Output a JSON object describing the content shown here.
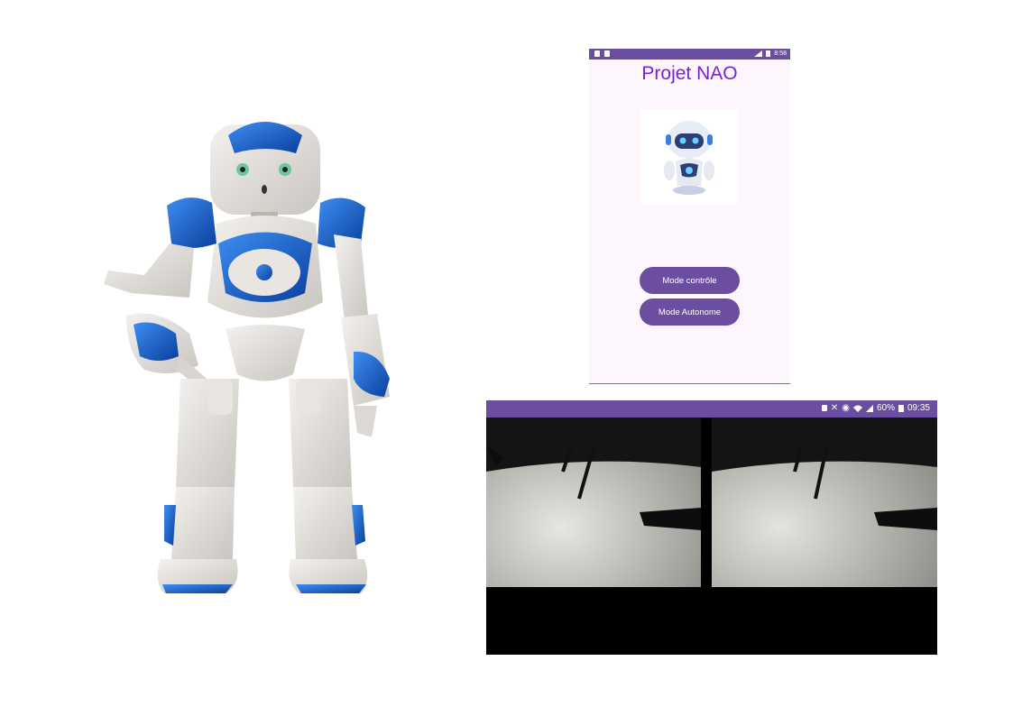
{
  "app": {
    "title": "Projet NAO",
    "status_time": "8:58",
    "buttons": {
      "control": "Mode contrôle",
      "autonomous": "Mode Autonome"
    }
  },
  "video_screen": {
    "status_battery": "60%",
    "status_time": "09:35"
  },
  "colors": {
    "accent": "#6b4ea0",
    "title": "#7a1fd9",
    "robot_blue": "#1560c9"
  },
  "icons": [
    "robot-photo",
    "robot-logo-icon",
    "battery-icon",
    "signal-icon",
    "wifi-icon",
    "alarm-icon",
    "mute-icon"
  ]
}
